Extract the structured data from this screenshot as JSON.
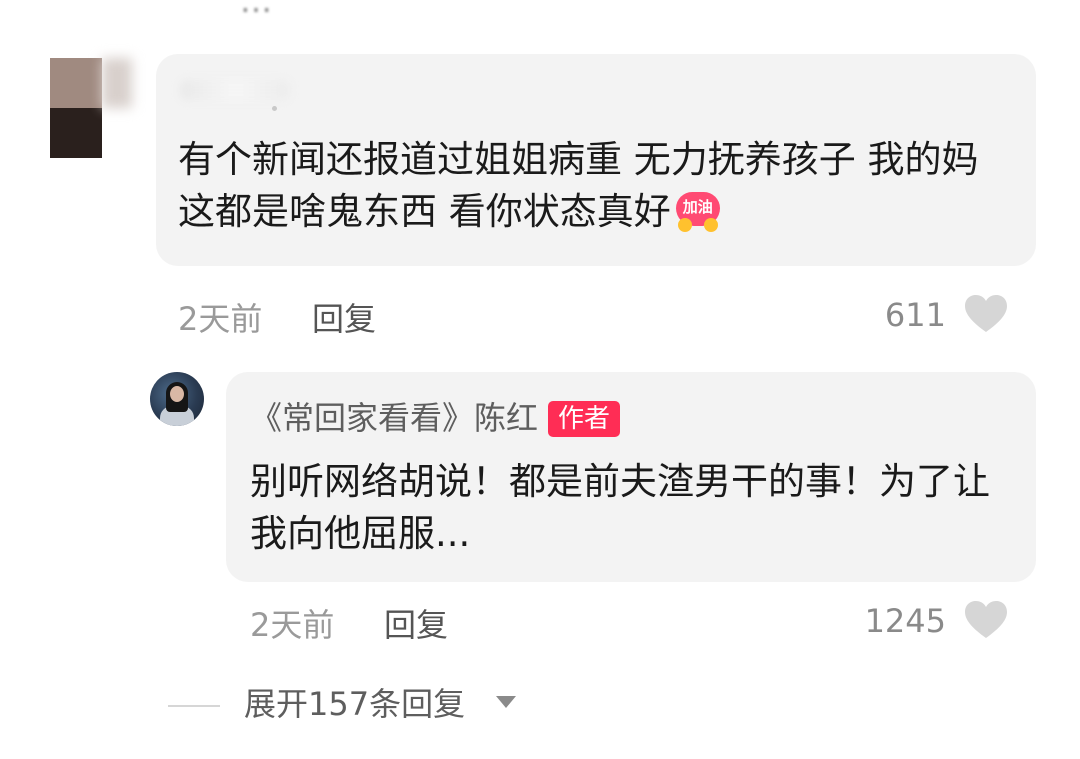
{
  "top_cut_text": "…",
  "comment": {
    "text": "有个新闻还报道过姐姐病重 无力抚养孩子 我的妈 这都是啥鬼东西 看你状态真好",
    "emoji_text": "加油",
    "time": "2天前",
    "reply_label": "回复",
    "likes": "611"
  },
  "reply": {
    "author": "《常回家看看》陈红",
    "badge": "作者",
    "text": "别听网络胡说！都是前夫渣男干的事！为了让我向他屈服...",
    "time": "2天前",
    "reply_label": "回复",
    "likes": "1245"
  },
  "expand": {
    "label": "展开157条回复"
  },
  "colors": {
    "bubble": "#f3f3f3",
    "badge": "#ff2d55",
    "heart": "#d6d6d6"
  }
}
